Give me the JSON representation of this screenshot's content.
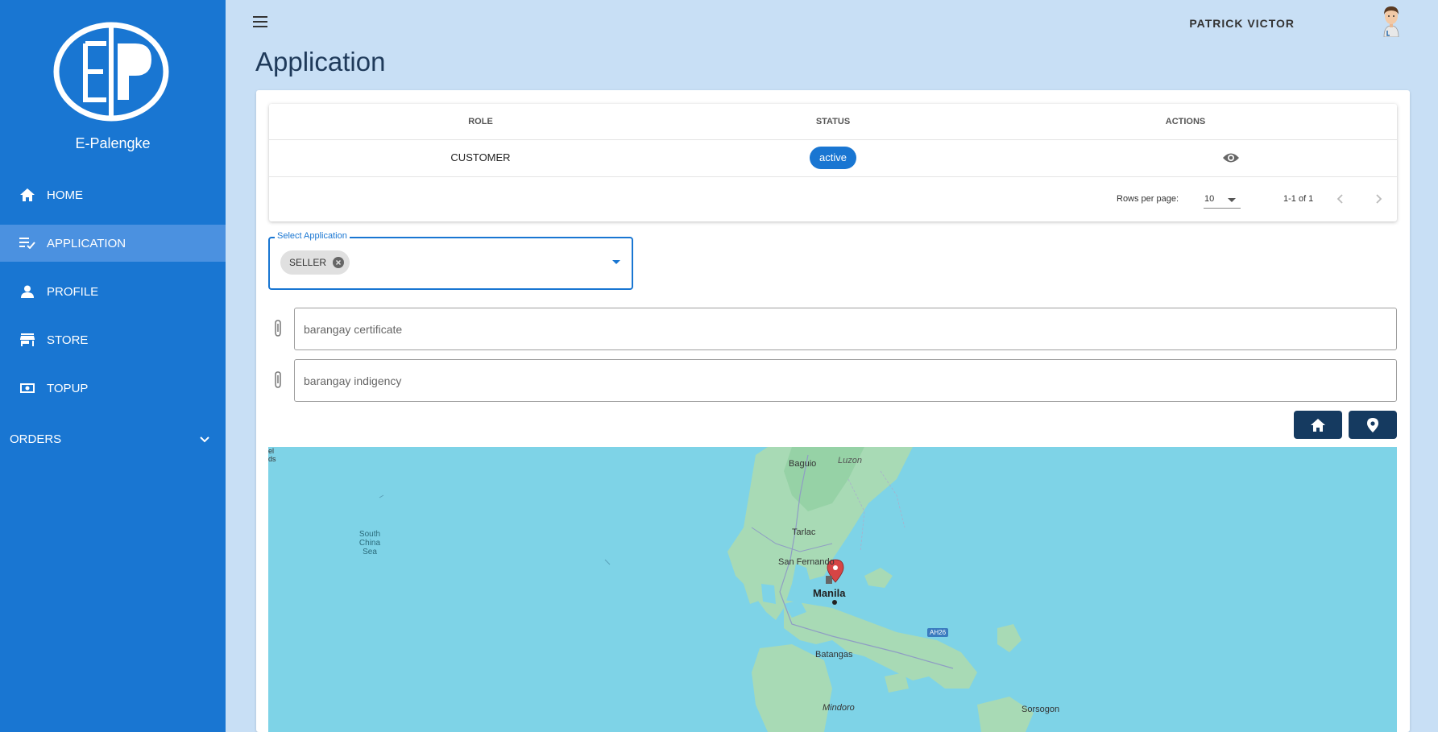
{
  "app": {
    "brand": "E-Palengke"
  },
  "sidebar": {
    "items": [
      {
        "label": "HOME",
        "icon": "home-icon"
      },
      {
        "label": "APPLICATION",
        "icon": "playlist-check-icon"
      },
      {
        "label": "PROFILE",
        "icon": "person-icon"
      },
      {
        "label": "STORE",
        "icon": "store-icon"
      },
      {
        "label": "TOPUP",
        "icon": "cash-icon"
      }
    ],
    "orders": {
      "label": "ORDERS",
      "icon": "chevron-down-icon"
    }
  },
  "header": {
    "user_name": "PATRICK VICTOR"
  },
  "page": {
    "title": "Application"
  },
  "table": {
    "headers": [
      "ROLE",
      "STATUS",
      "ACTIONS"
    ],
    "rows": [
      {
        "role": "CUSTOMER",
        "status": "active"
      }
    ],
    "rows_per_page_label": "Rows per page:",
    "rows_per_page_value": "10",
    "range_text": "1-1 of 1"
  },
  "select_application": {
    "label": "Select Application",
    "selected": [
      "SELLER"
    ]
  },
  "files": {
    "certificate_placeholder": "barangay certificate",
    "indigency_placeholder": "barangay indigency"
  },
  "map": {
    "labels": [
      "Baguio",
      "Luzon",
      "South China Sea",
      "Tarlac",
      "San Fernando",
      "Manila",
      "Batangas",
      "Mindoro",
      "Sorsogon",
      "AH26"
    ]
  },
  "colors": {
    "sidebar": "#1976d2",
    "active_item": "#4b91e0",
    "background": "#c8dff5",
    "map_button": "#153a60",
    "water": "#7ed3e7",
    "land": "#a8dab5"
  }
}
